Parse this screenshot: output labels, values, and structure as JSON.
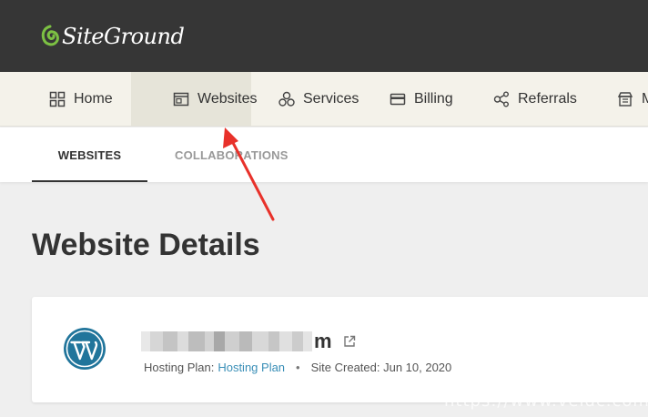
{
  "brand": {
    "name": "SiteGround",
    "accent": "#7cc143"
  },
  "nav": {
    "items": [
      {
        "label": "Home",
        "icon": "grid-icon"
      },
      {
        "label": "Websites",
        "icon": "browser-window-icon",
        "active": true
      },
      {
        "label": "Services",
        "icon": "cubes-icon"
      },
      {
        "label": "Billing",
        "icon": "credit-card-icon"
      },
      {
        "label": "Referrals",
        "icon": "share-icon"
      },
      {
        "label": "Ma",
        "icon": "marketplace-icon"
      }
    ]
  },
  "subnav": {
    "tabs": [
      {
        "label": "WEBSITES",
        "active": true
      },
      {
        "label": "COLLABORATIONS"
      }
    ]
  },
  "page": {
    "title": "Website Details"
  },
  "site": {
    "name_visible": "m",
    "hosting_plan_label": "Hosting Plan:",
    "hosting_plan_value": "Hosting Plan",
    "separator": "•",
    "created_label": "Site Created: Jun 10, 2020"
  },
  "watermark": "https://www.veidc.com",
  "colors": {
    "topbar": "#363636",
    "nav_bg": "#f4f2ea",
    "link": "#3a8fb7",
    "annotation_arrow": "#e8312a"
  }
}
